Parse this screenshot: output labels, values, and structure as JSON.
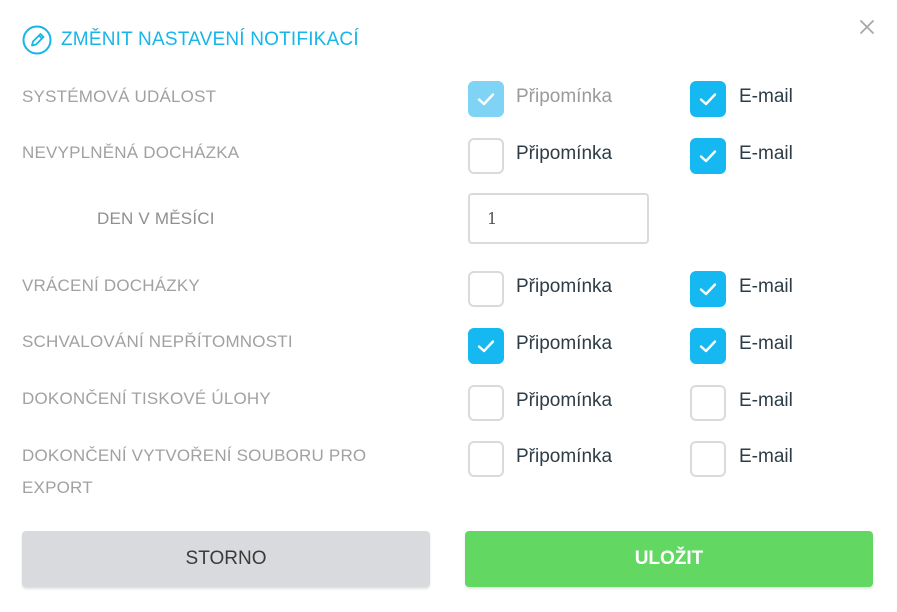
{
  "dialog": {
    "title": "ZMĚNIT NASTAVENÍ NOTIFIKACÍ",
    "accent_color": "#17b5ea",
    "close_icon": "close-icon",
    "edit_icon": "pencil-circle-icon"
  },
  "options": {
    "reminder": "Připomínka",
    "email": "E-mail"
  },
  "rows": [
    {
      "label": "SYSTÉMOVÁ UDÁLOST",
      "reminder": true,
      "reminder_disabled": true,
      "email": true
    },
    {
      "label": "NEVYPLNĚNÁ DOCHÁZKA",
      "reminder": false,
      "email": true
    },
    {
      "label": "VRÁCENÍ DOCHÁZKY",
      "reminder": false,
      "email": true
    },
    {
      "label": "SCHVALOVÁNÍ NEPŘÍTOMNOSTI",
      "reminder": true,
      "email": true
    },
    {
      "label": "DOKONČENÍ TISKOVÉ ÚLOHY",
      "reminder": false,
      "email": false
    },
    {
      "label": "DOKONČENÍ VYTVOŘENÍ SOUBORU PRO",
      "label_line2": "EXPORT",
      "reminder": false,
      "email": false
    }
  ],
  "day_field": {
    "label": "DEN V MĚSÍCI",
    "value": "1"
  },
  "buttons": {
    "cancel": "STORNO",
    "save": "ULOŽIT",
    "save_color": "#62d863",
    "checkbox_color": "#16b8f1"
  }
}
